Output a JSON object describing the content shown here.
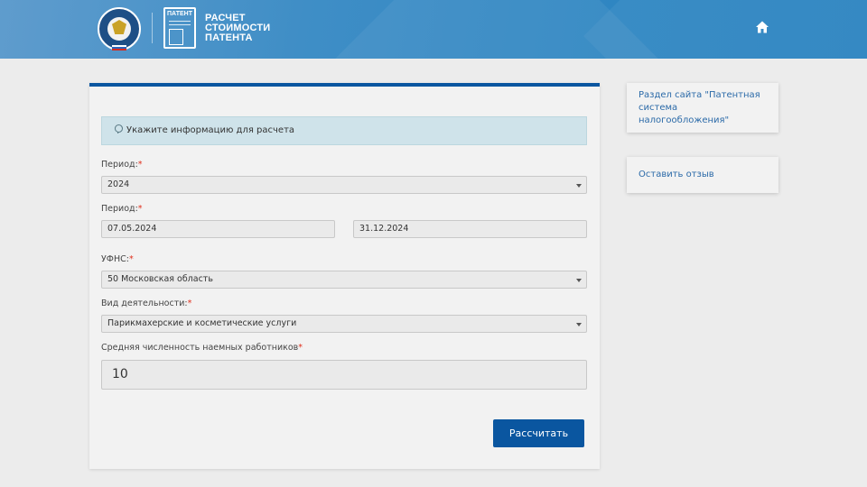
{
  "header": {
    "emblem_icon": "fns-emblem-icon",
    "patent_icon_text": "ПАТЕНТ",
    "title_lines": [
      "РАСЧЕТ",
      "СТОИМОСТИ",
      "ПАТЕНТА"
    ],
    "home_icon": "home-icon"
  },
  "colors": {
    "header_blue": "#3f8ec6",
    "accent": "#0a56a0",
    "info_bg": "#cfe3ea",
    "required": "#e0301e",
    "link": "#2b6aa8"
  },
  "form": {
    "info_icon": "info-icon",
    "info_text": "Укажите информацию для расчета",
    "period_label": "Период:",
    "period_year": "2024",
    "period_range_label": "Период:",
    "date_from": "07.05.2024",
    "date_to": "31.12.2024",
    "ufns_label": "УФНС:",
    "ufns_value": "50 Московская область",
    "activity_label": "Вид деятельности:",
    "activity_value": "Парикмахерские и косметические услуги",
    "employees_label": "Средняя численность наемных работников",
    "employees_value": "10",
    "required_mark": "*",
    "submit_label": "Рассчитать"
  },
  "sidebar": {
    "links": [
      {
        "label": "Раздел сайта \"Патентная система налогообложения\""
      },
      {
        "label": "Оставить отзыв"
      }
    ]
  }
}
